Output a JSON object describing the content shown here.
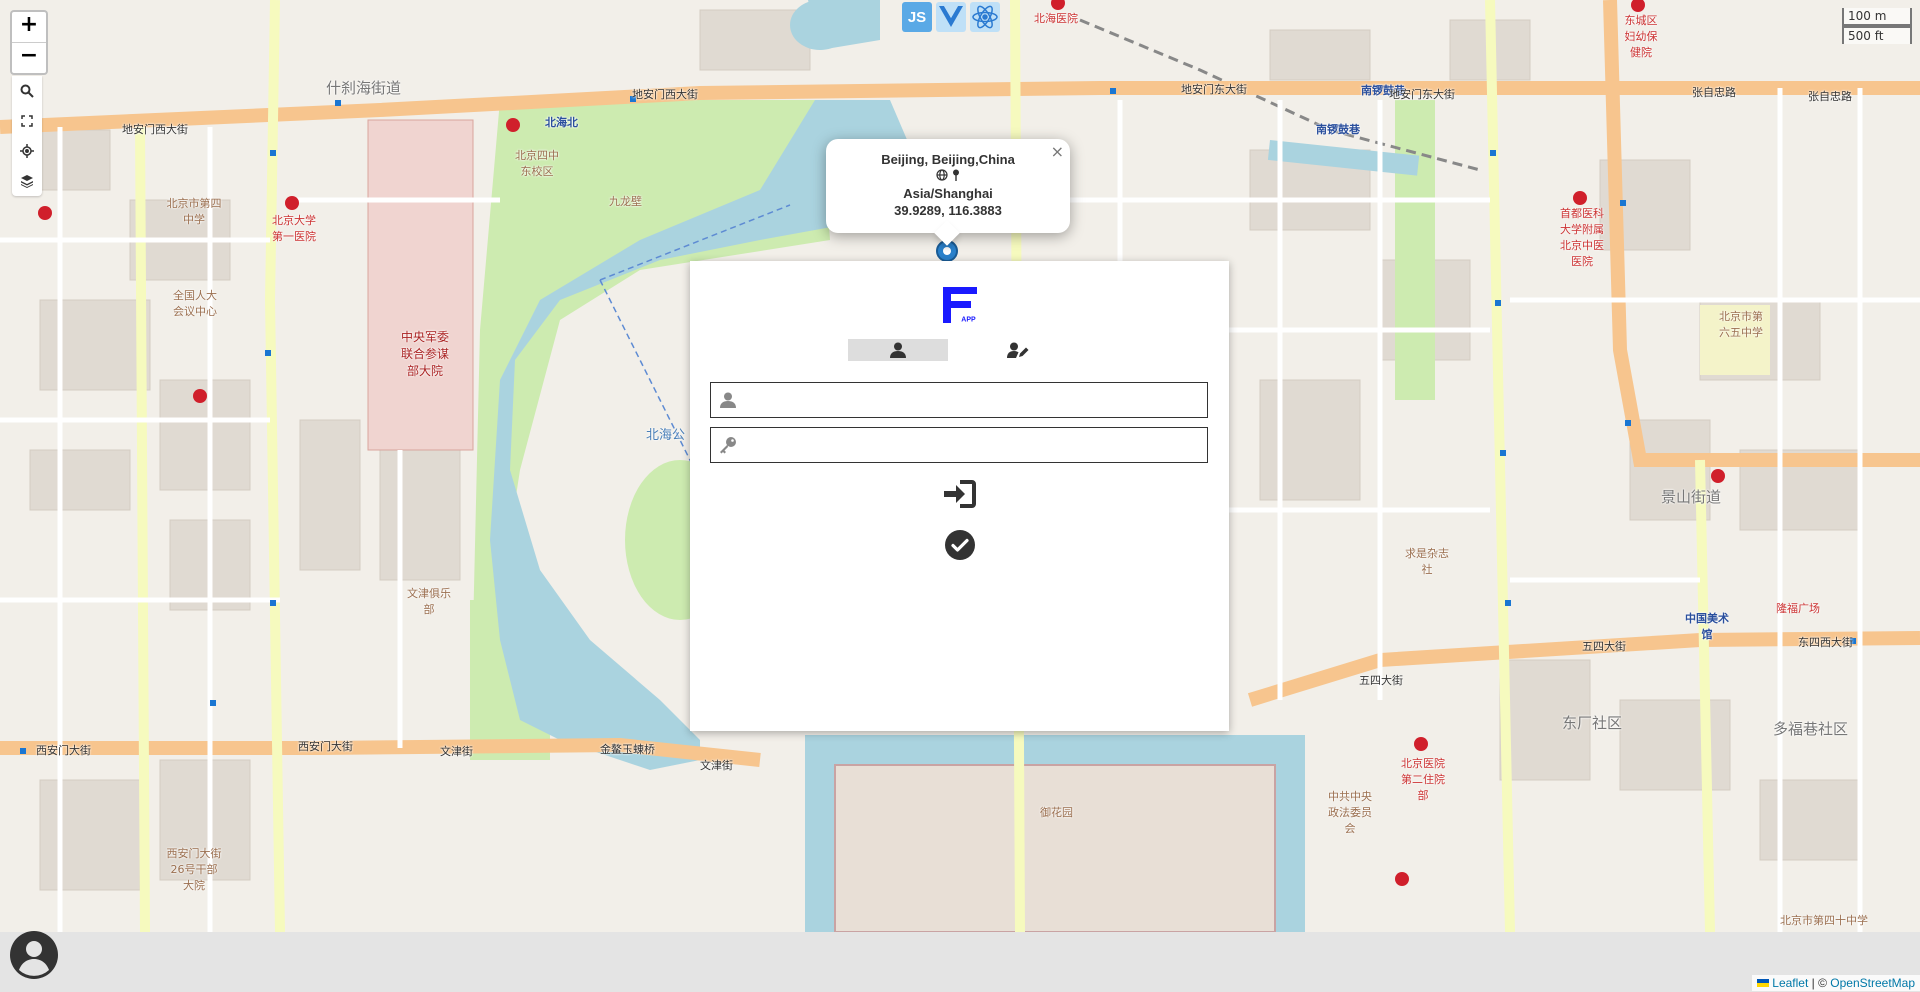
{
  "map": {
    "labels": {
      "shichahai_street": "什刹海街道",
      "jingshan_street": "景山街道",
      "dongcheng_community": "东厂社区",
      "duofuxiang": "多福巷社区",
      "beihai": "北海公",
      "beihai_north": "北海北",
      "nanluoguxiang": "南锣鼓巷",
      "nanluoguxiang2": "南锣鼓巷",
      "dianmen_west": "地安门西大街",
      "dianmen_west2": "地安门西大街",
      "dianmen_east": "地安门东大街",
      "dianmen_east2": "地安门东大街",
      "zhangzilu": "张自忠路",
      "zhangzilu2": "张自忠路",
      "xianmen_west": "西安门大街",
      "xianmen_west2": "西安门大街",
      "wenjin": "文津街",
      "wenjin2": "文津街",
      "wusi": "五四大街",
      "wusi2": "五四大街",
      "dongsi_west": "东四西大街",
      "jingbeiyuan": "金鳌玉蝀桥",
      "hospital_pku": "北京大学第一医院",
      "hospital_beihai": "北海医院",
      "hospital_capital": "首都医科大学附属北京中医医院",
      "hospital_bj2": "北京医院第二住院部",
      "hospital_maternity": "东城区妇幼保健院",
      "military": "中央军委联合参谋部大院",
      "school_4": "北京市第四中学",
      "school_65": "北京市第六五中学",
      "renda": "全国人大会议中心",
      "wenjin_club": "文津俱乐部",
      "qiushi": "求是杂志社",
      "art_museum": "中国美术馆",
      "longfu": "隆福广场",
      "xian_26": "西安门大街26号干部大院",
      "xisi_school": "北京市第四十中学",
      "jiulong": "九龙壁",
      "xicheng_school": "北京四中东校区",
      "yuhuayuan": "御花园",
      "zhongshan": "中共中央政法委员会"
    }
  },
  "controls": {
    "zoom_in": "+",
    "zoom_out": "−",
    "scale_m": "100 m",
    "scale_ft": "500 ft"
  },
  "tech_logos": {
    "js": "JS"
  },
  "popup": {
    "location": "Beijing, Beijing,China",
    "timezone": "Asia/Shanghai",
    "coords": "39.9289, 116.3883",
    "close": "×"
  },
  "login": {
    "username": {
      "value": "",
      "placeholder": ""
    },
    "password": {
      "value": "",
      "placeholder": ""
    }
  },
  "attribution": {
    "leaflet": "Leaflet",
    "separator": " | © ",
    "osm": "OpenStreetMap"
  },
  "colors": {
    "road_major": "#f7c58e",
    "road_minor": "#ffffff",
    "water": "#aad3df",
    "park": "#cdebb0",
    "brand_blue": "#1a1aff"
  }
}
